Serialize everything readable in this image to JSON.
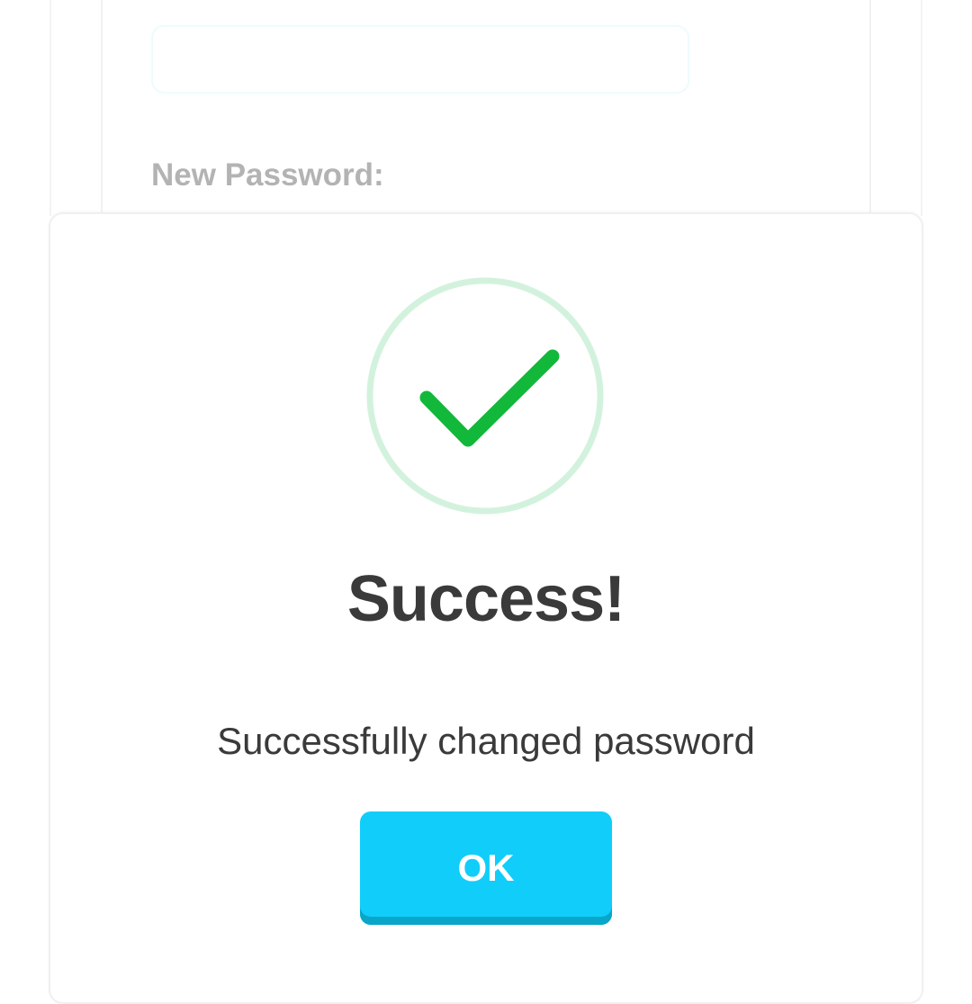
{
  "form": {
    "new_password_label": "New Password:"
  },
  "dialog": {
    "icon": "checkmark-circle-icon",
    "title": "Success!",
    "message": "Successfully changed password",
    "ok_label": "OK"
  },
  "colors": {
    "success_green": "#12b83a",
    "ring_green": "#d3f2de",
    "button_cyan": "#11cdf9",
    "button_shadow": "#0aa6c9",
    "text_dark": "#3a3a3a",
    "label_gray": "#b3b3b3"
  }
}
